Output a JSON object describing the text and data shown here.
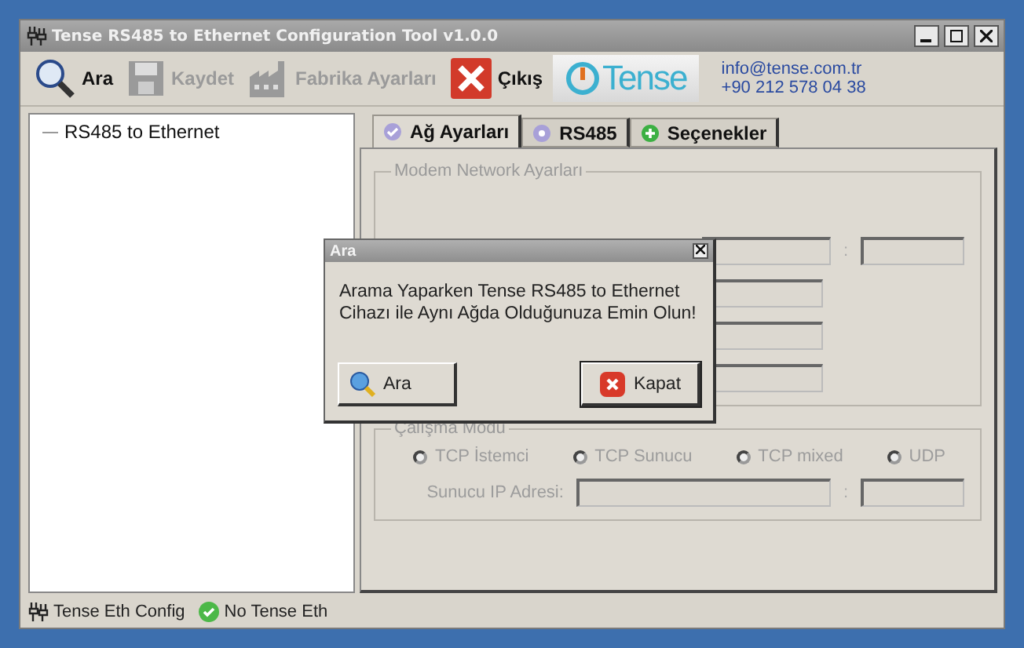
{
  "window": {
    "title": "Tense RS485 to Ethernet Configuration Tool v1.0.0"
  },
  "toolbar": [
    {
      "label": "Ara",
      "kind": "search",
      "disabled": false
    },
    {
      "label": "Kaydet",
      "kind": "save",
      "disabled": true
    },
    {
      "label": "Fabrika Ayarları",
      "kind": "factory",
      "disabled": true
    },
    {
      "label": "Çıkış",
      "kind": "exit",
      "disabled": false
    }
  ],
  "logo": {
    "text": "Tense"
  },
  "contact": [
    "info@tense.com.tr",
    "+90 212 578 04 38"
  ],
  "tree": [
    {
      "label": "RS485 to Ethernet",
      "selected": false
    }
  ],
  "tabs": [
    {
      "label": "Ağ Ayarları",
      "kind": "check",
      "selected": true
    },
    {
      "label": "RS485",
      "kind": "disc",
      "selected": false
    },
    {
      "label": "Seçenekler",
      "kind": "plus",
      "selected": false
    }
  ],
  "modem_group": {
    "title": "Modem Network Ayarları",
    "disabled": true,
    "rows": [
      {
        "separator": ":"
      },
      {},
      {},
      {}
    ]
  },
  "mode_group": {
    "title": "Çalışma Modu",
    "disabled": true,
    "options": [
      {
        "label": "TCP İstemci",
        "selected": false
      },
      {
        "label": "TCP Sunucu",
        "selected": false
      },
      {
        "label": "TCP mixed",
        "selected": false
      },
      {
        "label": "UDP",
        "selected": false
      }
    ],
    "server_label": "Sunucu IP Adresi:",
    "separator": ":"
  },
  "dialog": {
    "title": "Ara",
    "message": "Arama Yaparken Tense RS485 to Ethernet\nCihazı ile Aynı Ağda Olduğunuza Emin Olun!",
    "buttons": [
      {
        "label": "Ara",
        "kind": "search"
      },
      {
        "label": "Kapat",
        "kind": "close"
      }
    ]
  },
  "status_bar": [
    {
      "label": "Tense Eth Config",
      "kind": "app"
    },
    {
      "label": "No Tense Eth",
      "kind": "ok"
    }
  ]
}
